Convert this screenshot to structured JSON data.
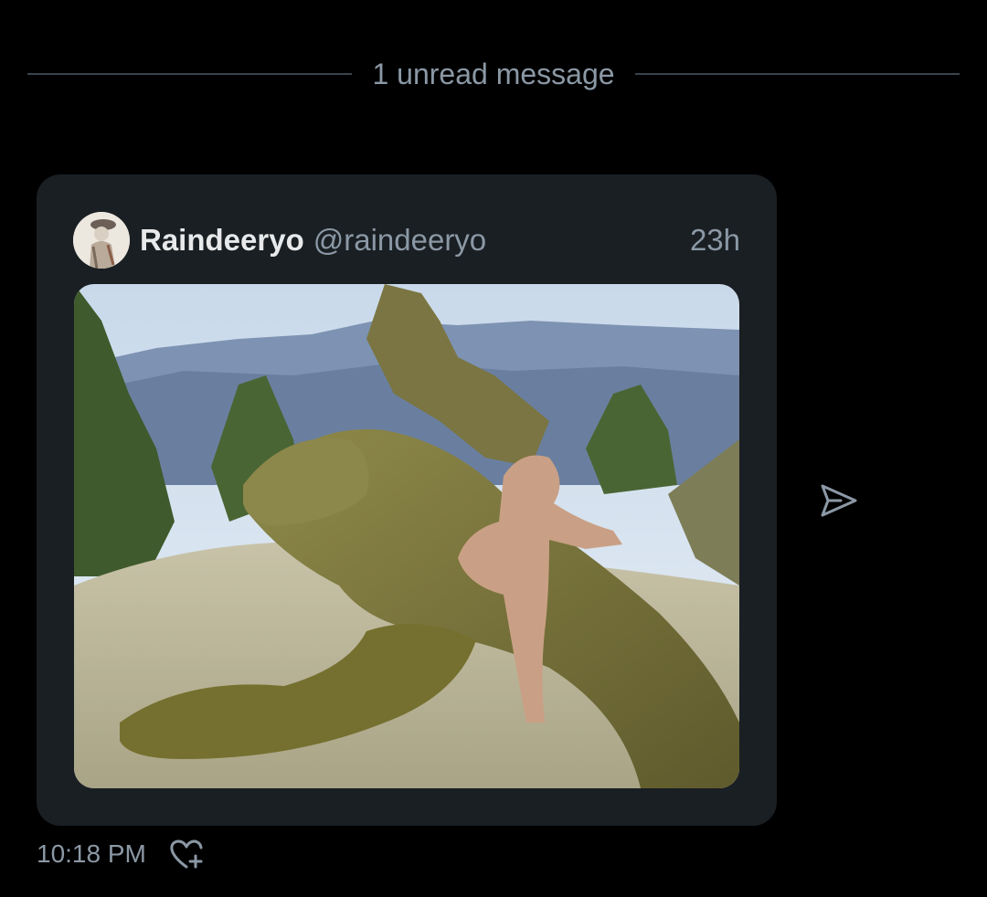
{
  "divider": {
    "label": "1 unread message"
  },
  "shared_tweet": {
    "display_name": "Raindeeryo",
    "handle": "@raindeeryo",
    "time_ago": "23h",
    "avatar_icon": "profile-avatar",
    "media_description_icon": "photo"
  },
  "message": {
    "time": "10:18 PM",
    "react_icon": "heart-plus-icon",
    "share_icon": "send-icon"
  },
  "colors": {
    "background": "#000000",
    "card": "#1a1f23",
    "secondary_text": "#8b98a5",
    "primary_text": "#e7e9ea",
    "icon": "#8b98a5"
  }
}
